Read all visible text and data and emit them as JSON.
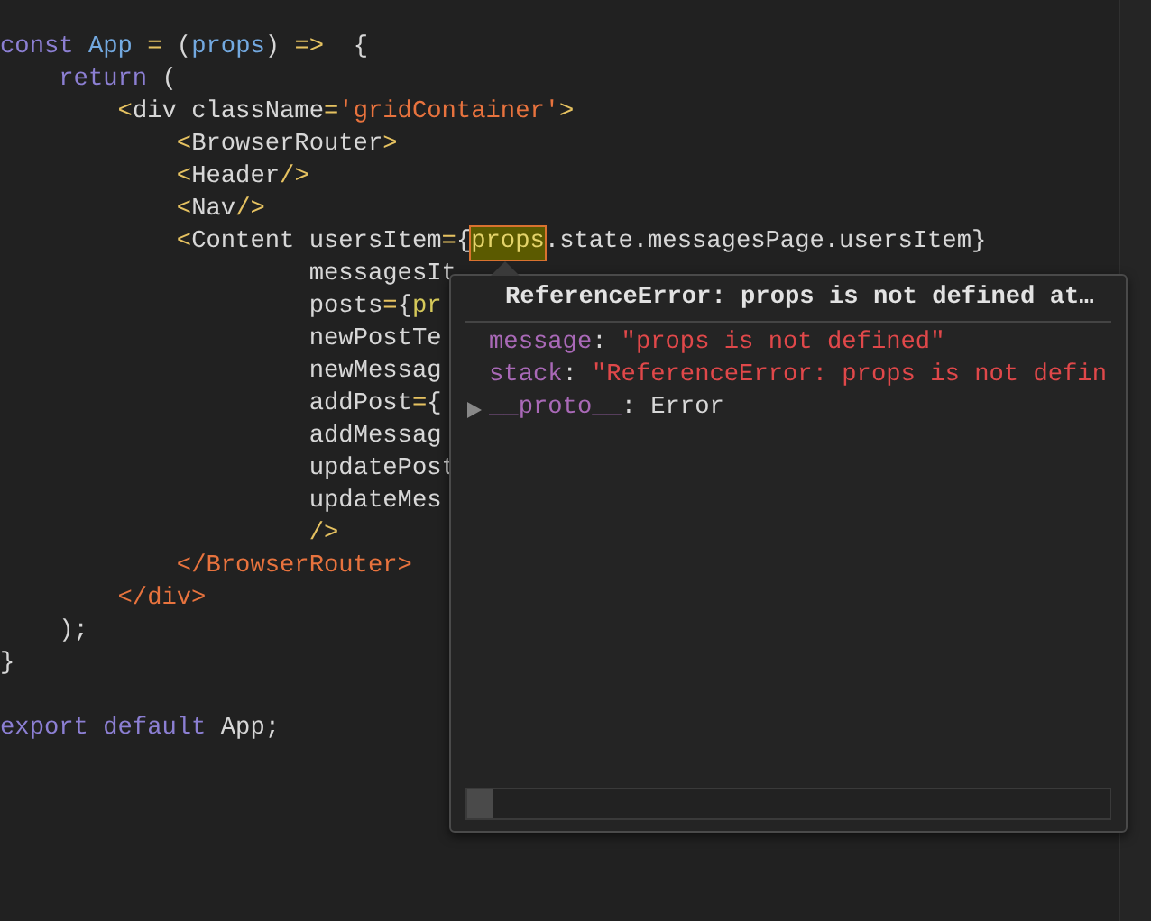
{
  "editor": {
    "lines": [
      {
        "tokens": [
          {
            "text": "const",
            "kind": "keyword"
          },
          {
            "text": " App",
            "kind": "name"
          },
          {
            "text": " =",
            "kind": "op"
          },
          {
            "text": " (",
            "kind": "plain"
          },
          {
            "text": "props",
            "kind": "name"
          },
          {
            "text": ") ",
            "kind": "plain"
          },
          {
            "text": "=>",
            "kind": "op"
          },
          {
            "text": "  {",
            "kind": "plain"
          }
        ]
      },
      {
        "tokens": [
          {
            "text": "    return",
            "kind": "keyword"
          },
          {
            "text": " (",
            "kind": "plain"
          }
        ]
      },
      {
        "tokens": [
          {
            "text": "        <",
            "kind": "op"
          },
          {
            "text": "div className",
            "kind": "plain"
          },
          {
            "text": "=",
            "kind": "op"
          },
          {
            "text": "'gridContainer'",
            "kind": "string"
          },
          {
            "text": ">",
            "kind": "op"
          }
        ]
      },
      {
        "tokens": [
          {
            "text": "            <",
            "kind": "op"
          },
          {
            "text": "BrowserRouter",
            "kind": "plain"
          },
          {
            "text": ">",
            "kind": "op"
          }
        ]
      },
      {
        "tokens": [
          {
            "text": "            <",
            "kind": "op"
          },
          {
            "text": "Header",
            "kind": "plain"
          },
          {
            "text": "/>",
            "kind": "op"
          }
        ]
      },
      {
        "tokens": [
          {
            "text": "            <",
            "kind": "op"
          },
          {
            "text": "Nav",
            "kind": "plain"
          },
          {
            "text": "/>",
            "kind": "op"
          }
        ]
      },
      {
        "tokens": [
          {
            "text": "            <",
            "kind": "op"
          },
          {
            "text": "Content usersItem",
            "kind": "plain"
          },
          {
            "text": "=",
            "kind": "op"
          },
          {
            "text": "{",
            "kind": "plain"
          },
          {
            "text": "props",
            "kind": "highlight"
          },
          {
            "text": ".state.messagesPage.usersItem}",
            "kind": "plain"
          }
        ]
      },
      {
        "tokens": [
          {
            "text": "                     messagesIt",
            "kind": "plain"
          }
        ]
      },
      {
        "tokens": [
          {
            "text": "                     posts",
            "kind": "plain"
          },
          {
            "text": "=",
            "kind": "op"
          },
          {
            "text": "{",
            "kind": "plain"
          },
          {
            "text": "pr",
            "kind": "ref"
          }
        ]
      },
      {
        "tokens": [
          {
            "text": "                     newPostTe",
            "kind": "plain"
          }
        ]
      },
      {
        "tokens": [
          {
            "text": "                     newMessag",
            "kind": "plain"
          }
        ]
      },
      {
        "tokens": [
          {
            "text": "                     addPost",
            "kind": "plain"
          },
          {
            "text": "=",
            "kind": "op"
          },
          {
            "text": "{",
            "kind": "plain"
          }
        ]
      },
      {
        "tokens": [
          {
            "text": "                     addMessag",
            "kind": "plain"
          }
        ]
      },
      {
        "tokens": [
          {
            "text": "                     updatePost",
            "kind": "plain"
          }
        ]
      },
      {
        "tokens": [
          {
            "text": "                     updateMes",
            "kind": "plain"
          }
        ]
      },
      {
        "tokens": [
          {
            "text": "                     />",
            "kind": "op"
          }
        ]
      },
      {
        "tokens": [
          {
            "text": "            </BrowserRouter>",
            "kind": "closing"
          }
        ]
      },
      {
        "tokens": [
          {
            "text": "        </div>",
            "kind": "closing"
          }
        ]
      },
      {
        "tokens": [
          {
            "text": "    );",
            "kind": "plain"
          }
        ]
      },
      {
        "tokens": [
          {
            "text": "}",
            "kind": "plain"
          }
        ]
      },
      {
        "blank_line_before": true,
        "tokens": [
          {
            "text": "export",
            "kind": "keyword"
          },
          {
            "text": " default",
            "kind": "keyword"
          },
          {
            "text": " App;",
            "kind": "plain"
          }
        ]
      }
    ]
  },
  "error_popup": {
    "title": "ReferenceError: props is not defined at…",
    "properties": [
      {
        "key": "message",
        "separator": ":",
        "value": "\"props is not defined\""
      },
      {
        "key": "stack",
        "separator": ":",
        "value": "\"ReferenceError: props is not defin"
      }
    ],
    "proto": {
      "key": "__proto__",
      "separator": ":",
      "value": "Error",
      "expanded": false
    }
  }
}
